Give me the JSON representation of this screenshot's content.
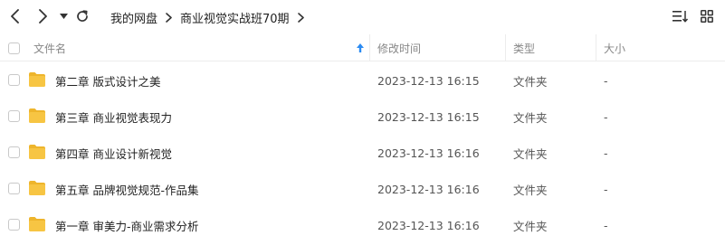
{
  "toolbar": {
    "back_icon": "chevron-left-icon",
    "forward_icon": "chevron-right-icon",
    "history_icon": "caret-down-icon",
    "refresh_icon": "refresh-icon",
    "sort_icon": "sort-list-icon",
    "grid_icon": "grid-view-icon"
  },
  "breadcrumb": {
    "items": [
      "我的网盘",
      "商业视觉实战班70期"
    ]
  },
  "header": {
    "name": "文件名",
    "modified": "修改时间",
    "type": "类型",
    "size": "大小",
    "sort_indicator_color": "#2b8bf2"
  },
  "rows": [
    {
      "name": "第二章 版式设计之美",
      "modified": "2023-12-13 16:15",
      "type": "文件夹",
      "size": "-"
    },
    {
      "name": "第三章 商业视觉表现力",
      "modified": "2023-12-13 16:15",
      "type": "文件夹",
      "size": "-"
    },
    {
      "name": "第四章 商业设计新视觉",
      "modified": "2023-12-13 16:16",
      "type": "文件夹",
      "size": "-"
    },
    {
      "name": "第五章 品牌视觉规范-作品集",
      "modified": "2023-12-13 16:16",
      "type": "文件夹",
      "size": "-"
    },
    {
      "name": "第一章 审美力-商业需求分析",
      "modified": "2023-12-13 16:16",
      "type": "文件夹",
      "size": "-"
    }
  ],
  "colors": {
    "folder": "#f7c543",
    "folder_tab": "#eeb52c"
  }
}
